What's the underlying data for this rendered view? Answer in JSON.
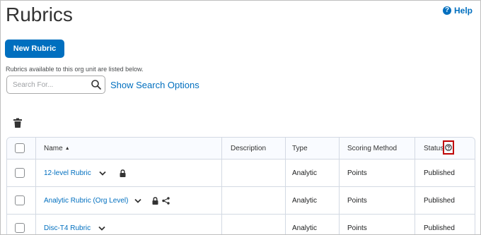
{
  "page": {
    "title": "Rubrics",
    "help_label": "Help"
  },
  "toolbar": {
    "new_button_label": "New Rubric",
    "info_text": "Rubrics available to this org unit are listed below."
  },
  "search": {
    "placeholder": "Search For...",
    "value": "",
    "options_label": "Show Search Options"
  },
  "table": {
    "headers": {
      "name": "Name",
      "description": "Description",
      "type": "Type",
      "scoring": "Scoring Method",
      "status": "Status"
    },
    "rows": [
      {
        "name": "12-level Rubric",
        "description": "",
        "type": "Analytic",
        "scoring": "Points",
        "status": "Published",
        "locked": true,
        "shared": false
      },
      {
        "name": "Analytic Rubric (Org Level)",
        "description": "",
        "type": "Analytic",
        "scoring": "Points",
        "status": "Published",
        "locked": true,
        "shared": true
      },
      {
        "name": "Disc-T4 Rubric",
        "description": "",
        "type": "Analytic",
        "scoring": "Points",
        "status": "Published",
        "locked": false,
        "shared": false
      }
    ]
  },
  "icons": {
    "help": "help-circle-icon",
    "search": "magnifier-icon",
    "delete": "trash-icon",
    "sort": "sort-ascending-icon",
    "row_menu": "chevron-down-icon",
    "lock": "lock-icon",
    "share": "share-icon",
    "status_help": "question-circle-icon"
  },
  "colors": {
    "accent": "#006fbf",
    "highlight_box": "#c00000",
    "header_bg": "#f9fbff",
    "grid_border": "#d3d9e3"
  }
}
